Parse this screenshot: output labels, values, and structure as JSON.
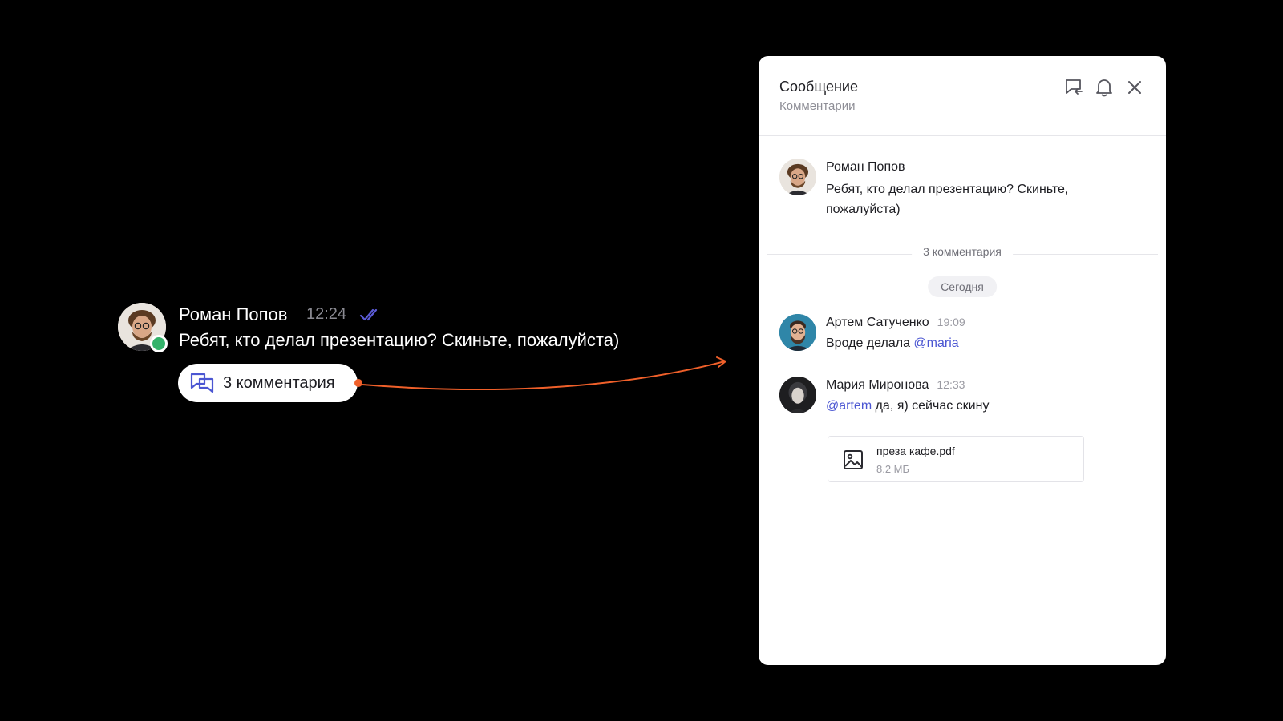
{
  "message": {
    "author": "Роман Попов",
    "time": "12:24",
    "text": "Ребят, кто делал презентацию? Скиньте, пожалуйста)",
    "thread_button_label": "3 комментария",
    "status_color": "#33b36b",
    "checks_color": "#5b5bd6",
    "connector_color": "#f0602a"
  },
  "panel": {
    "title": "Сообщение",
    "subtitle": "Комментарии",
    "icons": [
      "reply-thread-icon",
      "bell-icon",
      "close-icon"
    ],
    "root": {
      "author": "Роман Попов",
      "text": "Ребят, кто делал презентацию? Скиньте, пожалуйста)"
    },
    "comments_count_label": "3 комментария",
    "day_label": "Сегодня",
    "comments": [
      {
        "author": "Артем Сатученко",
        "time": "19:09",
        "text": "Вроде делала ",
        "mention": "@maria"
      },
      {
        "author": "Мария Миронова",
        "time": "12:33",
        "mention": "@artem",
        "text": " да, я) сейчас скину"
      }
    ],
    "attachment": {
      "name": "преза кафе.pdf",
      "size": "8.2 МБ",
      "icon": "image-file-icon"
    }
  }
}
